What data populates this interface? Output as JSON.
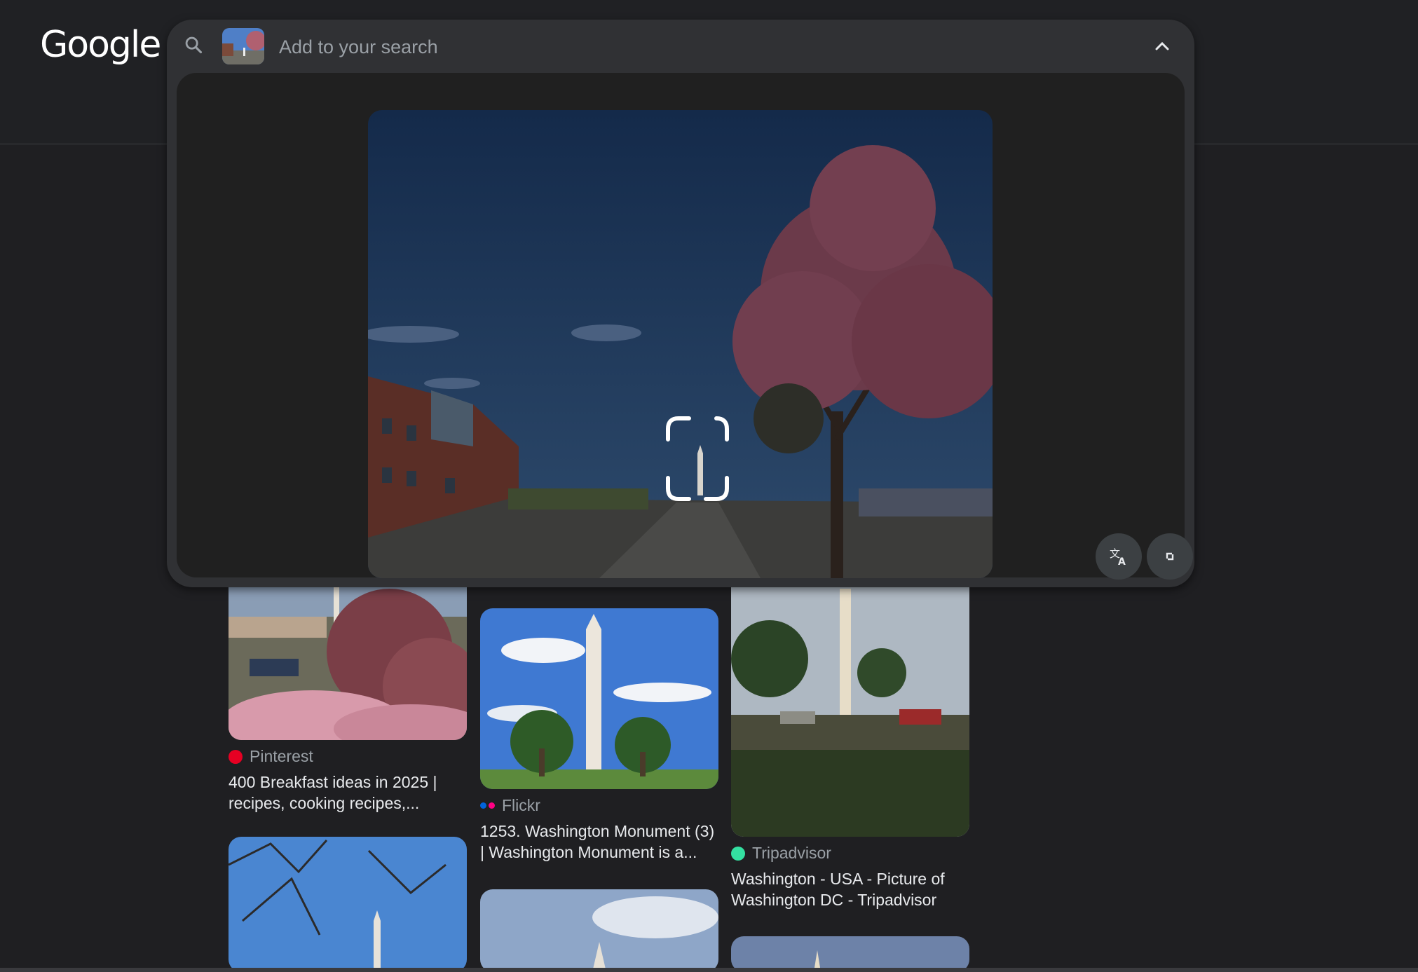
{
  "logo": "Google",
  "search": {
    "placeholder": "Add to your search"
  },
  "results": [
    {
      "source": "Pinterest",
      "title": "400 Breakfast ideas in 2025 | recipes, cooking recipes,..."
    },
    {
      "source": "Flickr",
      "title": "1253. Washington Monument (3) | Washington Monument is a..."
    },
    {
      "source": "Tripadvisor",
      "title": "Washington - USA - Picture of Washington DC - Tripadvisor"
    }
  ],
  "icons": [
    "search-icon",
    "chevron-up-icon",
    "translate-icon",
    "expand-icon",
    "pinterest-icon",
    "flickr-icon",
    "tripadvisor-icon"
  ],
  "colors": {
    "background": "#1f1f22",
    "panel": "#303134",
    "pinterest": "#e60023",
    "tripadvisor": "#34e0a1"
  }
}
